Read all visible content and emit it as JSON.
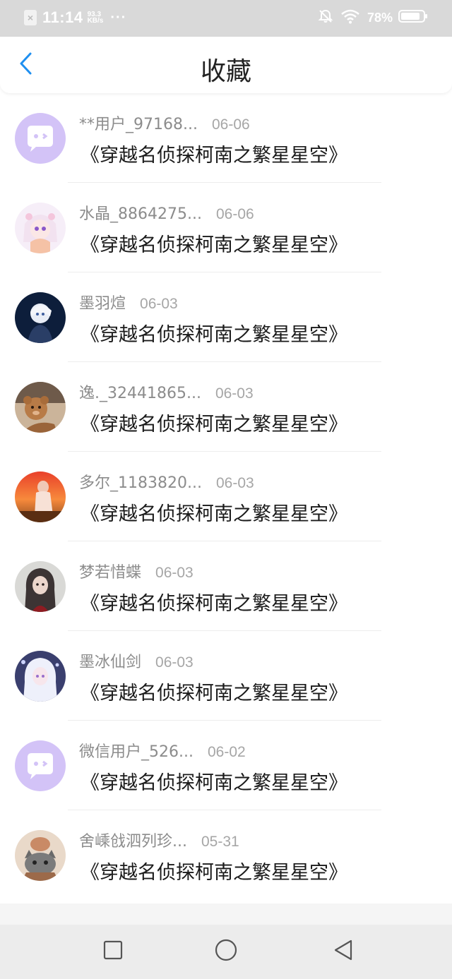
{
  "status_bar": {
    "time": "11:14",
    "speed_value": "93.3",
    "speed_unit": "KB/s",
    "dots": "···",
    "battery_percent": "78%"
  },
  "header": {
    "title": "收藏",
    "back_icon": "chevron-left-icon",
    "accent_color": "#1e8ff0"
  },
  "items": [
    {
      "username": "**用户_97168...",
      "date": "06-06",
      "title": "《穿越名侦探柯南之繁星星空》",
      "avatar": "default-chat"
    },
    {
      "username": "水晶_8864275...",
      "date": "06-06",
      "title": "《穿越名侦探柯南之繁星星空》",
      "avatar": "anime-pink"
    },
    {
      "username": "墨羽煊",
      "date": "06-03",
      "title": "《穿越名侦探柯南之繁星星空》",
      "avatar": "anime-dark-blue"
    },
    {
      "username": "逸._32441865...",
      "date": "06-03",
      "title": "《穿越名侦探柯南之繁星星空》",
      "avatar": "teddy-bear"
    },
    {
      "username": "多尔_1183820...",
      "date": "06-03",
      "title": "《穿越名侦探柯南之繁星星空》",
      "avatar": "sunset-girl"
    },
    {
      "username": "梦若惜蝶",
      "date": "06-03",
      "title": "《穿越名侦探柯南之繁星星空》",
      "avatar": "dark-hair-girl"
    },
    {
      "username": "墨冰仙剑",
      "date": "06-03",
      "title": "《穿越名侦探柯南之繁星星空》",
      "avatar": "white-hair-girl"
    },
    {
      "username": "微信用户_526...",
      "date": "06-02",
      "title": "《穿越名侦探柯南之繁星星空》",
      "avatar": "default-chat"
    },
    {
      "username": "舍嵊戗泗列珍...",
      "date": "05-31",
      "title": "《穿越名侦探柯南之繁星星空》",
      "avatar": "cat-cartoon"
    }
  ],
  "navbar": {
    "recent_icon": "square-icon",
    "home_icon": "circle-icon",
    "back_icon": "triangle-back-icon"
  },
  "colors": {
    "status_bar_bg": "#d9d9d9",
    "default_avatar_bg": "#d3c3f7",
    "username_gray": "#8c8c8c",
    "navbar_bg": "#ececec"
  }
}
